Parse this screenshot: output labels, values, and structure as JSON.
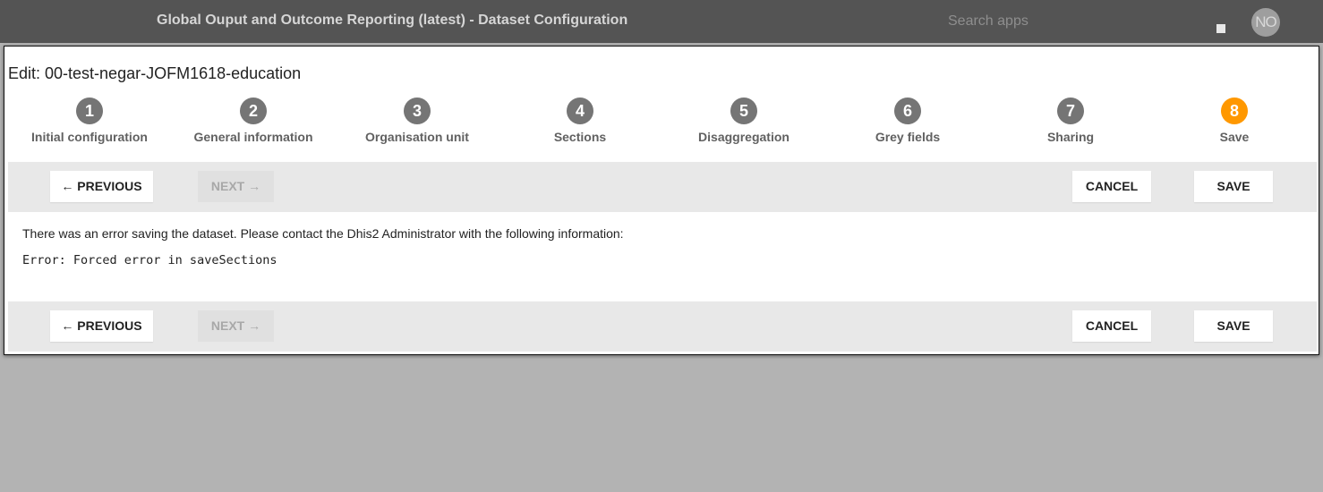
{
  "header": {
    "app_title": "Global Ouput and Outcome Reporting (latest) - Dataset Configuration",
    "search_placeholder": "Search apps",
    "apps_icon": "apps-menu-icon",
    "avatar_initials": "NO",
    "background_color": "#545454"
  },
  "dialog": {
    "title": "Edit: 00-test-negar-JOFM1618-education",
    "steps": [
      {
        "number": "1",
        "label": "Initial configuration",
        "active": false
      },
      {
        "number": "2",
        "label": "General information",
        "active": false
      },
      {
        "number": "3",
        "label": "Organisation unit",
        "active": false
      },
      {
        "number": "4",
        "label": "Sections",
        "active": false
      },
      {
        "number": "5",
        "label": "Disaggregation",
        "active": false
      },
      {
        "number": "6",
        "label": "Grey fields",
        "active": false
      },
      {
        "number": "7",
        "label": "Sharing",
        "active": false
      },
      {
        "number": "8",
        "label": "Save",
        "active": true
      }
    ],
    "step_colors": {
      "inactive": "#757575",
      "active": "#ff9800"
    },
    "actions": {
      "previous_label": "← PREVIOUS",
      "next_label": "NEXT →",
      "next_disabled": true,
      "cancel_label": "CANCEL",
      "save_label": "SAVE"
    },
    "error": {
      "message": "There was an error saving the dataset. Please contact the Dhis2 Administrator with the following information:",
      "detail": "Error: Forced error in saveSections"
    }
  }
}
